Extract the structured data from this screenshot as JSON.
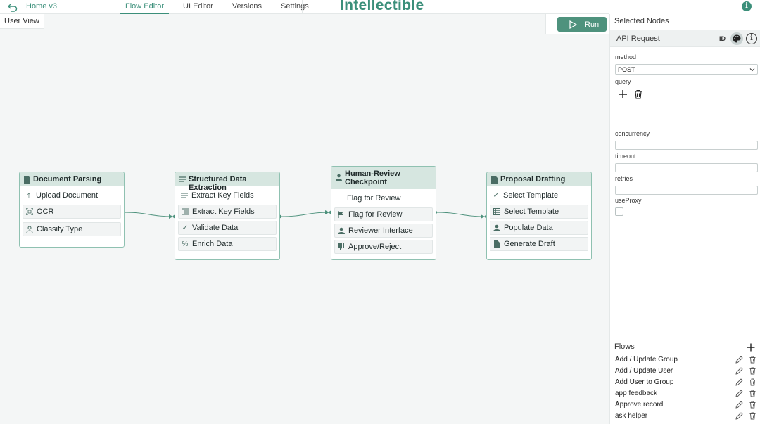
{
  "header": {
    "home_label": "Home v3",
    "tabs": [
      {
        "label": "Flow Editor",
        "active": true
      },
      {
        "label": "UI Editor",
        "active": false
      },
      {
        "label": "Versions",
        "active": false
      },
      {
        "label": "Settings",
        "active": false
      }
    ],
    "brand": "Intellectible",
    "info_icon": "i"
  },
  "view_label": "User View",
  "run_label": "Run",
  "colors": {
    "accent": "#3b8f7a",
    "node_border": "#8fc1b1",
    "node_header": "#d6e6e0"
  },
  "nodes": [
    {
      "title": "Document Parsing",
      "rows": [
        {
          "label": "Upload Document",
          "icon": "upload-icon"
        },
        {
          "label": "OCR",
          "icon": "scan-icon"
        },
        {
          "label": "Classify Type",
          "icon": "tag-icon"
        }
      ]
    },
    {
      "title": "Structured Data Extraction",
      "rows": [
        {
          "label": "Extract Key Fields",
          "icon": "lines-icon"
        },
        {
          "label": "Extract Key Fields",
          "icon": "list-icon"
        },
        {
          "label": "Validate Data",
          "icon": "check-icon"
        },
        {
          "label": "Enrich Data",
          "icon": "percent-icon"
        }
      ]
    },
    {
      "title": "Human-Review Checkpoint",
      "rows": [
        {
          "label": "Flag for Review",
          "icon": ""
        },
        {
          "label": "Flag for Review",
          "icon": "flag-icon"
        },
        {
          "label": "Reviewer Interface",
          "icon": "person-icon"
        },
        {
          "label": "Approve/Reject",
          "icon": "thumb-down-icon"
        }
      ]
    },
    {
      "title": "Proposal Drafting",
      "rows": [
        {
          "label": "Select Template",
          "icon": "check-icon"
        },
        {
          "label": "Select Template",
          "icon": "table-icon"
        },
        {
          "label": "Populate Data",
          "icon": "person-icon"
        },
        {
          "label": "Generate Draft",
          "icon": "document-icon"
        }
      ]
    }
  ],
  "panel": {
    "title": "Selected Nodes",
    "selected_node": "API Request",
    "id_label": "ID",
    "info_icon": "i",
    "fields": {
      "method_label": "method",
      "method_value": "POST",
      "query_label": "query",
      "concurrency_label": "concurrency",
      "timeout_label": "timeout",
      "retries_label": "retries",
      "useproxy_label": "useProxy"
    },
    "flows_title": "Flows",
    "flows": [
      "Add / Update Group",
      "Add / Update User",
      "Add User to Group",
      "app feedback",
      "Approve record",
      "ask helper"
    ]
  }
}
